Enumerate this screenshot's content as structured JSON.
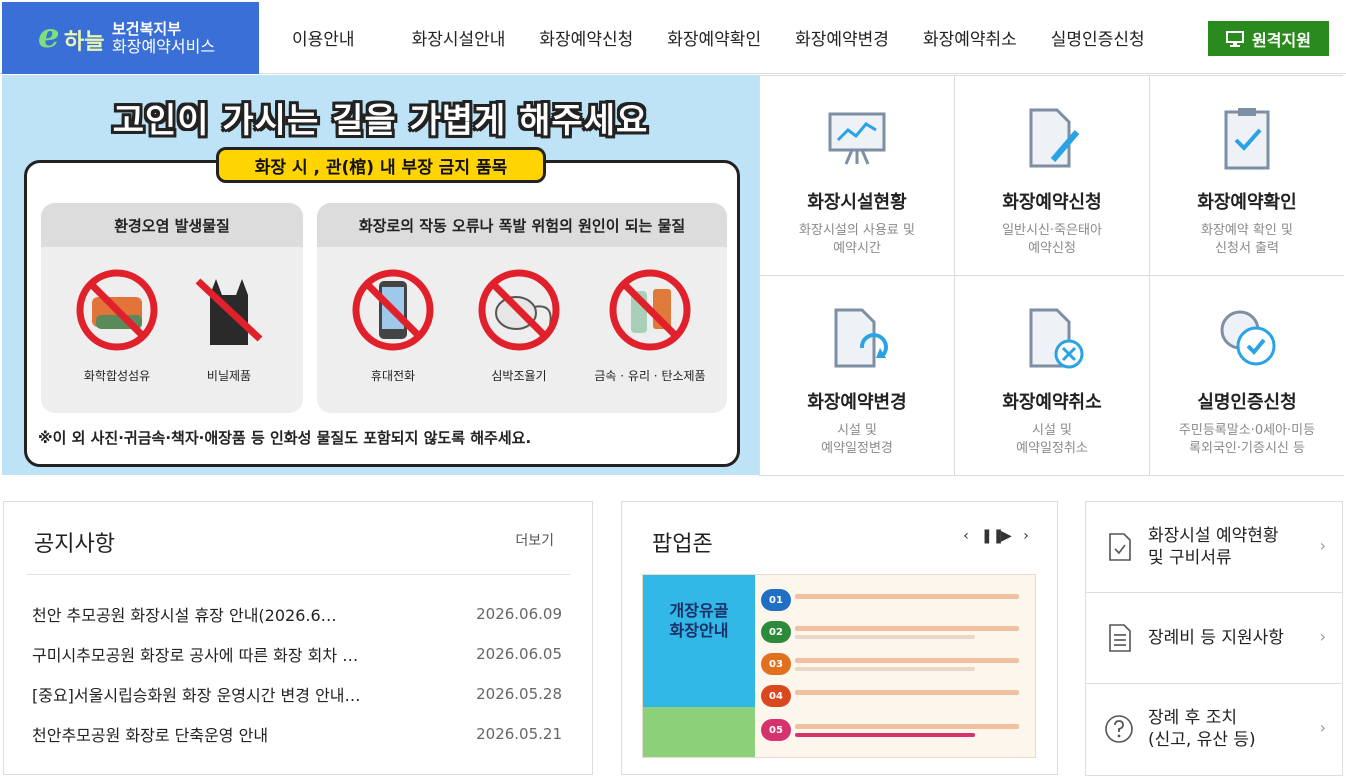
{
  "header": {
    "logo_mark": "e하늘",
    "logo_line1": "보건복지부",
    "logo_line2": "화장예약서비스",
    "nav": [
      "이용안내",
      "화장시설안내",
      "화장예약신청",
      "화장예약확인",
      "화장예약변경",
      "화장예약취소",
      "실명인증신청"
    ],
    "remote_label": "원격지원",
    "remote_color": "#2b8a1d"
  },
  "banner": {
    "title": "고인이 가시는 길을 가볍게 해주세요",
    "subtitle": "화장 시 , 관(棺) 내 부장 금지 품목",
    "panel1_title": "환경오염 발생물질",
    "panel2_title": "화장로의 작동 오류나 폭발 위험의 원인이 되는 물질",
    "items": [
      "화학합성섬유",
      "비닐제품",
      "휴대전화",
      "심박조율기",
      "금속 · 유리 · 탄소제품"
    ],
    "note": "※이 외 사진·귀금속·책자·애장품 등 인화성 물질도 포함되지 않도록 해주세요."
  },
  "services": [
    {
      "title": "화장시설현황",
      "desc": "화장시설의 사용료 및\n예약시간",
      "icon": "presentation-chart-icon"
    },
    {
      "title": "화장예약신청",
      "desc": "일반시신·죽은태아\n예약신청",
      "icon": "document-pen-icon"
    },
    {
      "title": "화장예약확인",
      "desc": "화장예약 확인 및\n신청서 출력",
      "icon": "clipboard-check-icon"
    },
    {
      "title": "화장예약변경",
      "desc": "시설 및\n예약일정변경",
      "icon": "document-refresh-icon"
    },
    {
      "title": "화장예약취소",
      "desc": "시설 및\n예약일정취소",
      "icon": "document-cancel-icon"
    },
    {
      "title": "실명인증신청",
      "desc": "주민등록말소·0세아·미등\n록외국인·기증시신 등",
      "icon": "face-check-icon"
    }
  ],
  "notice": {
    "title": "공지사항",
    "more": "더보기",
    "items": [
      {
        "title": "천안 추모공원 화장시설 휴장 안내(2026.6…",
        "date": "2026.06.09"
      },
      {
        "title": "구미시추모공원 화장로 공사에 따른 화장 회차 …",
        "date": "2026.06.05"
      },
      {
        "title": "[중요]서울시립승화원 화장 운영시간 변경 안내…",
        "date": "2026.05.28"
      },
      {
        "title": "천안추모공원 화장로 단축운영 안내",
        "date": "2026.05.21"
      }
    ]
  },
  "popup": {
    "title": "팝업존",
    "controls": [
      "‹",
      "❚❚",
      "▶",
      "›"
    ],
    "image_title": "개장유골\n화장안내",
    "steps": [
      "01",
      "02",
      "03",
      "04",
      "05"
    ],
    "step_colors": [
      "#1f6fc4",
      "#2e8a3b",
      "#e07020",
      "#d9481f",
      "#d6336c"
    ]
  },
  "side_links": [
    {
      "label": "화장시설 예약현황\n및 구비서류",
      "icon": "document-check-icon"
    },
    {
      "label": "장례비 등 지원사항",
      "icon": "document-list-icon"
    },
    {
      "label": "장례 후 조치\n(신고, 유산 등)",
      "icon": "question-circle-icon"
    }
  ]
}
